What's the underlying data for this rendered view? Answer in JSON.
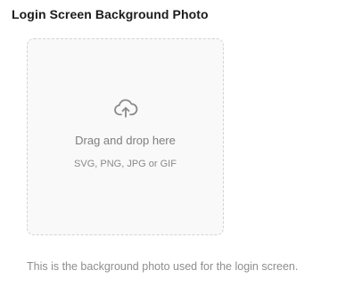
{
  "field": {
    "title": "Login Screen Background Photo",
    "helper_text": "This is the background photo used for the login screen."
  },
  "dropzone": {
    "icon": "cloud-upload-icon",
    "label": "Drag and drop here",
    "formats": "SVG, PNG, JPG or GIF"
  }
}
